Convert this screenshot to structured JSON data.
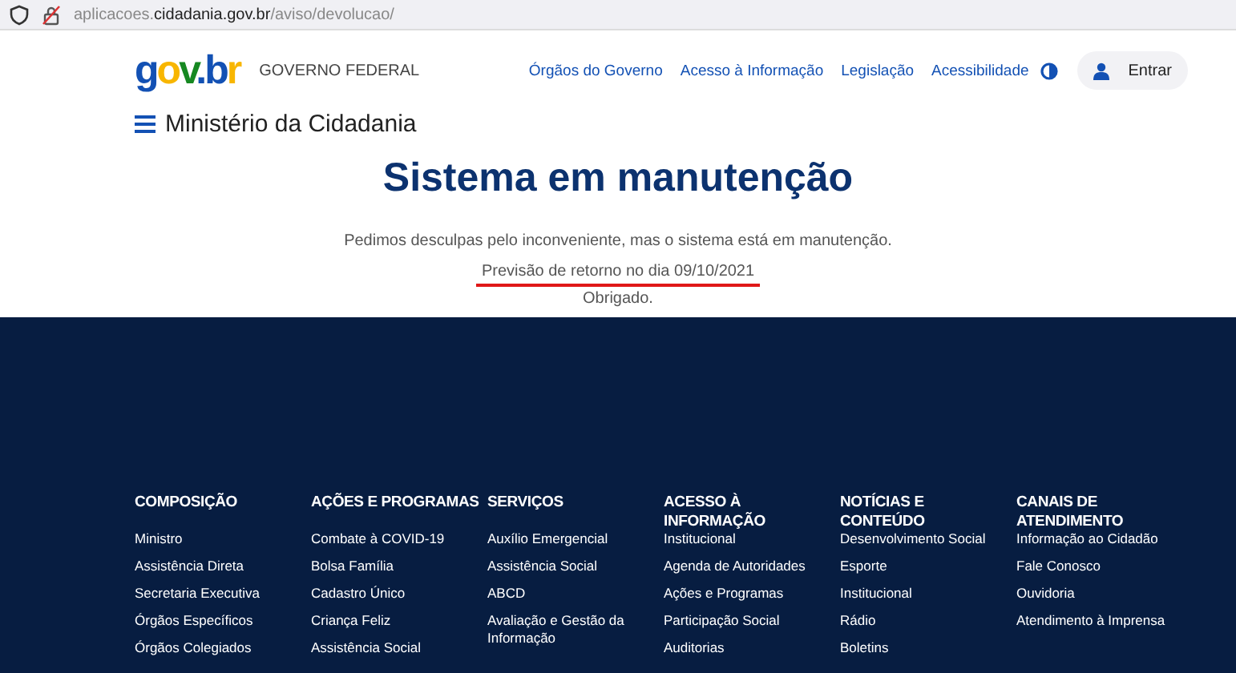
{
  "browser": {
    "url": "aplicacoes.**cidadania.gov.br**/aviso/devolucao/"
  },
  "header": {
    "logo": "gov.br",
    "logo_caption": "GOVERNO FEDERAL",
    "links": [
      "Órgãos do Governo",
      "Acesso à Informação",
      "Legislação",
      "Acessibilidade"
    ],
    "login_button": "Entrar",
    "ministry": "Ministério da Cidadania"
  },
  "main": {
    "title": "Sistema em manutenção",
    "lines": [
      {
        "text": "Pedimos desculpas pelo inconveniente, mas o sistema está em manutenção.",
        "underlined": false
      },
      {
        "text": "Previsão de retorno no dia 09/10/2021",
        "underlined": true
      },
      {
        "text": "Obrigado.",
        "underlined": false
      }
    ]
  },
  "footer": {
    "columns": [
      {
        "heading": "COMPOSIÇÃO",
        "links": [
          "Ministro",
          "Assistência Direta",
          "Secretaria Executiva",
          "Órgãos Específicos",
          "Órgãos Colegiados"
        ]
      },
      {
        "heading": "AÇÕES E PROGRAMAS",
        "links": [
          "Combate à COVID-19",
          "Bolsa Família",
          "Cadastro Único",
          "Criança Feliz",
          "Assistência Social"
        ]
      },
      {
        "heading": "SERVIÇOS",
        "links": [
          "Auxílio Emergencial",
          "Assistência Social",
          "ABCD",
          "Avaliação e Gestão da Informação"
        ]
      },
      {
        "heading": "ACESSO À INFORMAÇÃO",
        "links": [
          "Institucional",
          "Agenda de Autoridades",
          "Ações e Programas",
          "Participação Social",
          "Auditorias"
        ]
      },
      {
        "heading": "NOTÍCIAS E CONTEÚDO",
        "links": [
          "Desenvolvimento Social",
          "Esporte",
          "Institucional",
          "Rádio",
          "Boletins"
        ]
      },
      {
        "heading": "CANAIS DE ATENDIMENTO",
        "links": [
          "Informação ao Cidadão",
          "Fale Conosco",
          "Ouvidoria",
          "Atendimento à Imprensa"
        ]
      }
    ]
  }
}
